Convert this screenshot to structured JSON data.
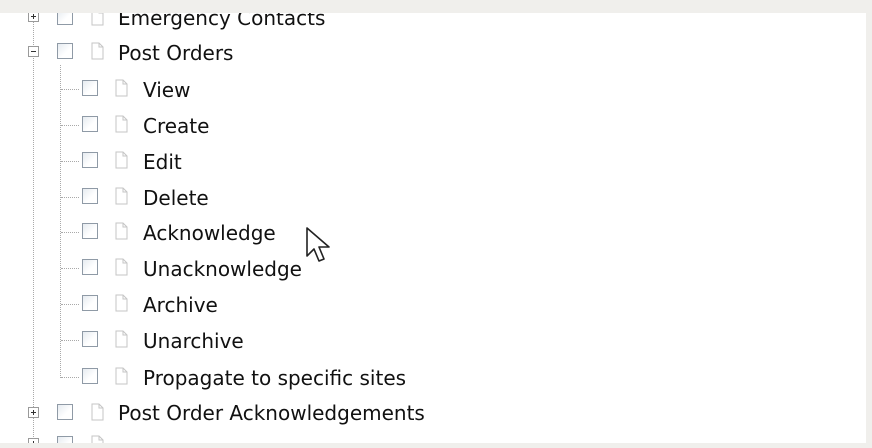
{
  "tree": {
    "top_item": "Emergency Contacts",
    "parent": "Post Orders",
    "children": [
      "View",
      "Create",
      "Edit",
      "Delete",
      "Acknowledge",
      "Unacknowledge",
      "Archive",
      "Unarchive",
      "Propagate to specific sites"
    ],
    "sibling": "Post Order Acknowledgements"
  }
}
